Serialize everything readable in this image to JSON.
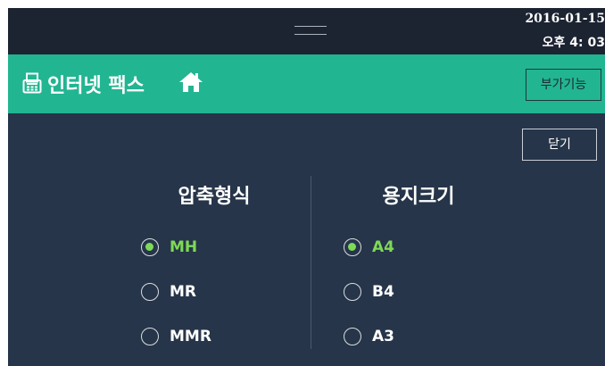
{
  "status_bar": {
    "date": "2016-01-15",
    "time": "오후 4: 03"
  },
  "header": {
    "title": "인터넷 팩스",
    "extra_button": "부가기능",
    "colors": {
      "header_bg": "#22b592",
      "screen_bg": "#263549",
      "selected": "#7ed957"
    }
  },
  "close_button": "닫기",
  "compression": {
    "title": "압축형식",
    "options": [
      {
        "label": "MH",
        "selected": true
      },
      {
        "label": "MR",
        "selected": false
      },
      {
        "label": "MMR",
        "selected": false
      }
    ]
  },
  "paper_size": {
    "title": "용지크기",
    "options": [
      {
        "label": "A4",
        "selected": true
      },
      {
        "label": "B4",
        "selected": false
      },
      {
        "label": "A3",
        "selected": false
      }
    ]
  },
  "icons": [
    "fax-icon",
    "home-icon",
    "drag-handle-icon"
  ]
}
